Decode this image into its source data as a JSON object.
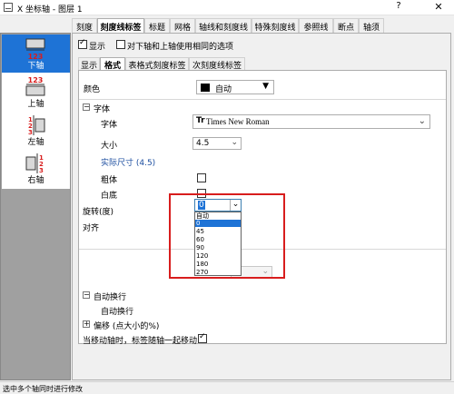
{
  "window": {
    "title": "X 坐标轴 - 图层 1",
    "help": "?",
    "close": "✕"
  },
  "axes": [
    {
      "label": "下轴",
      "icon": "bottom-axis-icon",
      "selected": true
    },
    {
      "label": "上轴",
      "icon": "top-axis-icon",
      "selected": false
    },
    {
      "label": "左轴",
      "icon": "left-axis-icon",
      "selected": false
    },
    {
      "label": "右轴",
      "icon": "right-axis-icon",
      "selected": false
    }
  ],
  "axis_icon_digits": "123",
  "tabs": [
    "刻度",
    "刻度线标签",
    "标题",
    "网格",
    "轴线和刻度线",
    "特殊刻度线",
    "参照线",
    "断点",
    "轴须"
  ],
  "active_tab": "刻度线标签",
  "show": {
    "label": "显示",
    "checked": true
  },
  "same_options": {
    "label": "对下轴和上轴使用相同的选项",
    "checked": false
  },
  "subtabs": [
    "显示",
    "格式",
    "表格式刻度标签",
    "次刻度线标签"
  ],
  "active_subtab": "格式",
  "props": {
    "color_label": "颜色",
    "color_value": "自动",
    "font_section": "字体",
    "font_label": "字体",
    "font_value": "Times New Roman",
    "font_icon": "Tr",
    "size_label": "大小",
    "size_value": "4.5",
    "actual_size": "实际尺寸 (4.5)",
    "bold_label": "粗体",
    "white_label": "白底",
    "rotation_label": "旋转(度)",
    "rotation_value": "0",
    "align_label": "对齐",
    "wrap_section": "自动换行",
    "wrap_label": "自动换行",
    "offset_label": "偏移 (点大小的%)",
    "move_label": "当移动轴时，标签随轴一起移动"
  },
  "rotation_options": [
    "自动",
    "0",
    "45",
    "60",
    "90",
    "120",
    "180",
    "270"
  ],
  "rotation_selected": "0",
  "status": "选中多个轴同时进行修改",
  "colors": {
    "selection": "#1e73d6",
    "highlight": "#d81d1d"
  }
}
